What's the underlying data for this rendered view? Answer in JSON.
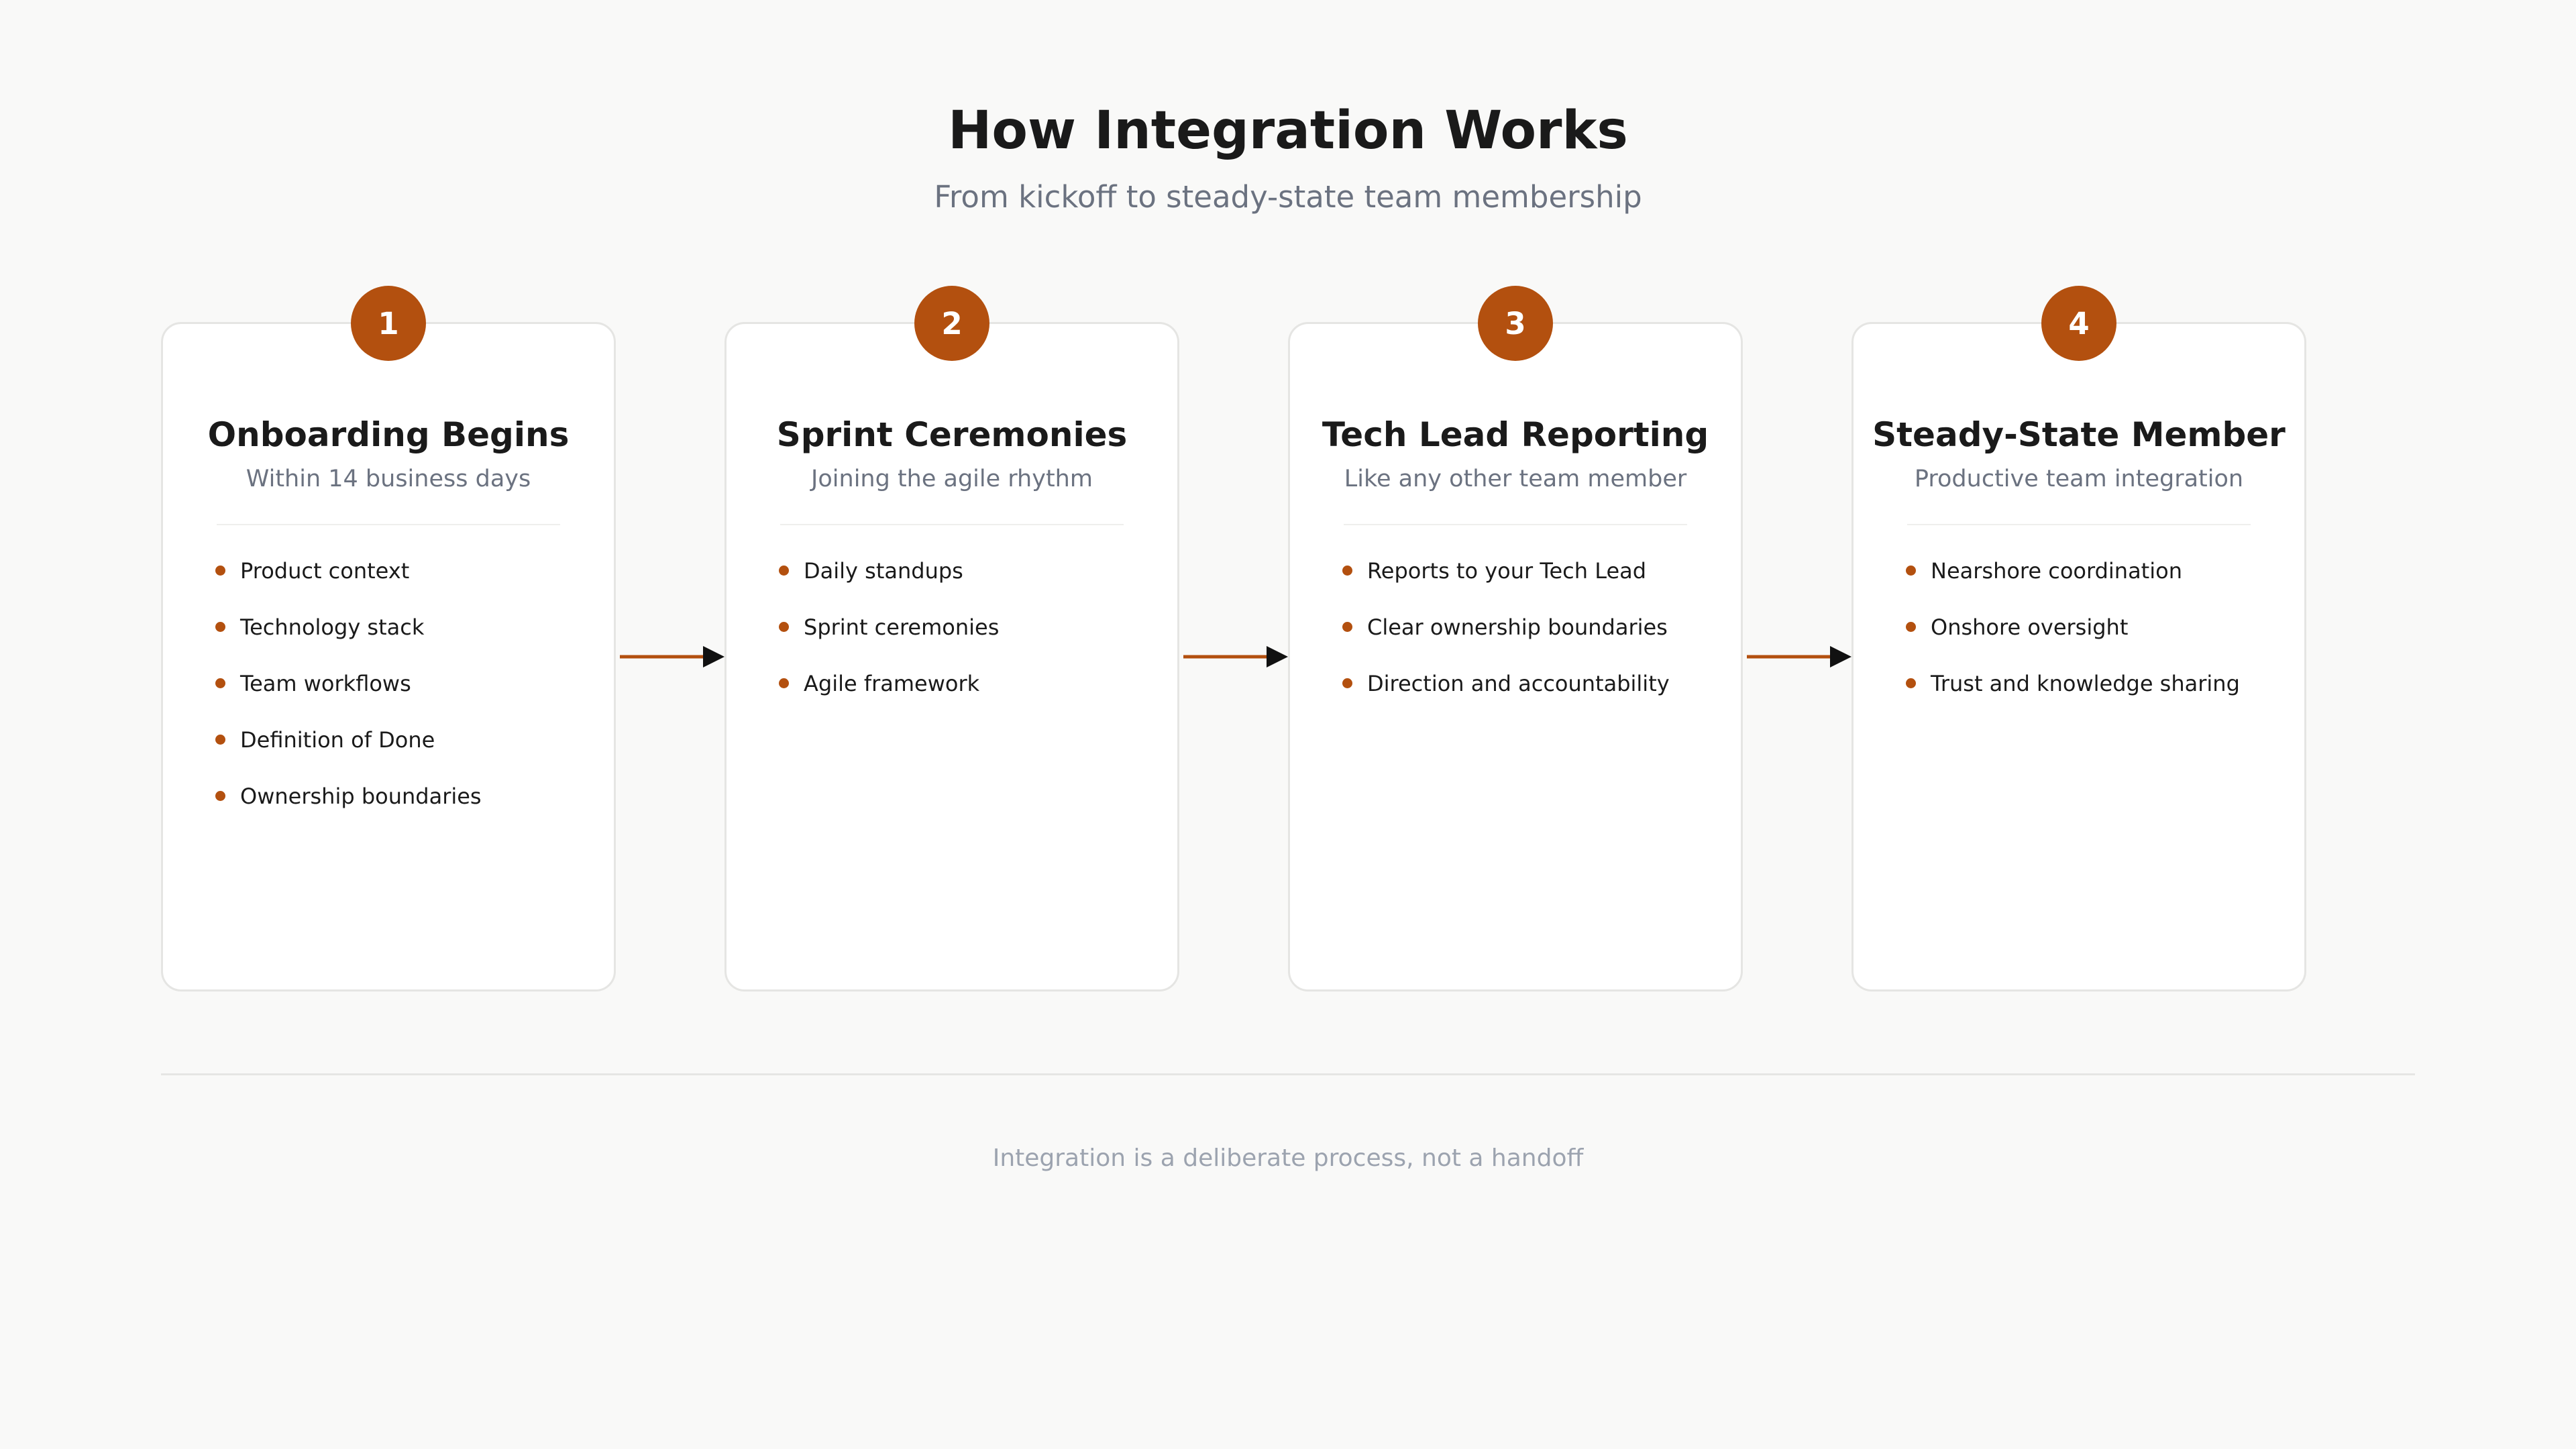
{
  "header": {
    "title": "How Integration Works",
    "subtitle": "From kickoff to steady-state team membership"
  },
  "steps": [
    {
      "number": "1",
      "title": "Onboarding Begins",
      "subtitle": "Within 14 business days",
      "items": [
        "Product context",
        "Technology stack",
        "Team workflows",
        "Definition of Done",
        "Ownership boundaries"
      ]
    },
    {
      "number": "2",
      "title": "Sprint Ceremonies",
      "subtitle": "Joining the agile rhythm",
      "items": [
        "Daily standups",
        "Sprint ceremonies",
        "Agile framework"
      ]
    },
    {
      "number": "3",
      "title": "Tech Lead Reporting",
      "subtitle": "Like any other team member",
      "items": [
        "Reports to your Tech Lead",
        "Clear ownership boundaries",
        "Direction and accountability"
      ]
    },
    {
      "number": "4",
      "title": "Steady-State Member",
      "subtitle": "Productive team integration",
      "items": [
        "Nearshore coordination",
        "Onshore oversight",
        "Trust and knowledge sharing"
      ]
    }
  ],
  "footer": {
    "caption": "Integration is a deliberate process, not a handoff"
  },
  "colors": {
    "accent": "#b3500f",
    "background": "#f9f9f8",
    "card": "#ffffff",
    "text": "#1a1a1a",
    "muted": "#6b7280",
    "arrowhead": "#111111"
  }
}
